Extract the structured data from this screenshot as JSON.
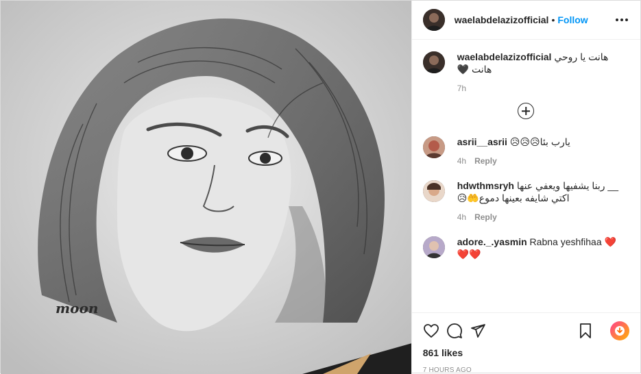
{
  "post": {
    "author": "waelabdelazizofficial",
    "follow_separator": "•",
    "follow_label": "Follow",
    "image_signature": "moon"
  },
  "caption": {
    "username": "waelabdelazizofficial",
    "text_line1": "هانت يا روحي",
    "text_line2": "هانت 🖤",
    "time": "7h"
  },
  "comments": [
    {
      "username": "asrii__asrii",
      "text": "يارب بئا😥😥😥",
      "time": "4h",
      "reply_label": "Reply"
    },
    {
      "username": "hdwthmsryh",
      "text": "__ ربنا يشفيها ويعفي عنها",
      "text2": "اكتي شايفه بعينها دموع🤲😥",
      "time": "4h",
      "reply_label": "Reply"
    },
    {
      "username": "adore._.yasmin",
      "text": "Rabna yeshfihaa ❤️",
      "text2": "❤️❤️"
    }
  ],
  "likes": "861 likes",
  "posted": "7 HOURS AGO",
  "colors": {
    "follow": "#0095f6",
    "muted": "#8e8e8e",
    "text": "#262626"
  },
  "icons": [
    "heart-icon",
    "comment-icon",
    "share-icon",
    "bookmark-icon",
    "download-icon",
    "more-icon",
    "add-comment-icon"
  ]
}
